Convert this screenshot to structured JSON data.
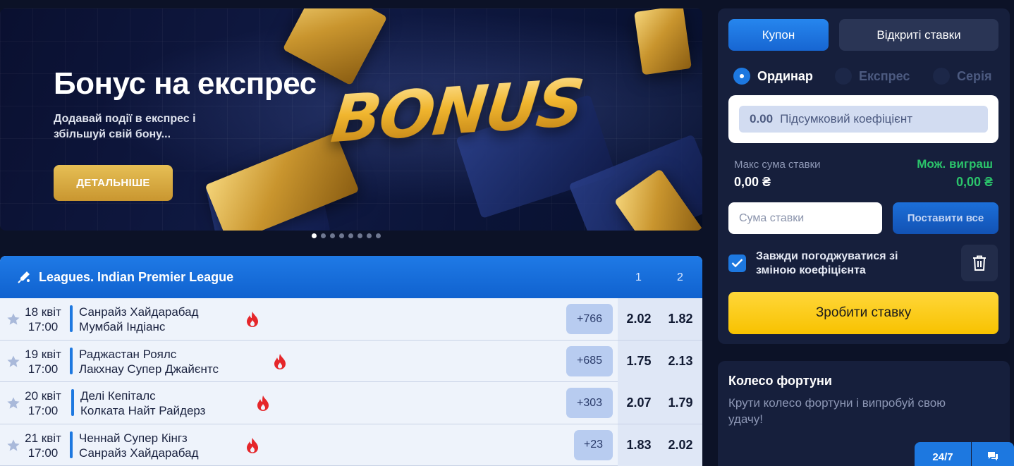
{
  "banner": {
    "title": "Бонус на експрес",
    "text": "Додавай події в експрес і збільшуй свій бону...",
    "button_label": "ДЕТАЛЬНІШЕ",
    "bonus_word": "BONUS",
    "slides_count": 8,
    "active_slide": 1
  },
  "league": {
    "name": "Leagues. Indian Premier League",
    "col1": "1",
    "col2": "2"
  },
  "matches": [
    {
      "date": "18 квіт",
      "time": "17:00",
      "team1": "Санрайз Хайдарабад",
      "team2": "Мумбай Індіанс",
      "markets": "+766",
      "odd1": "2.02",
      "odd2": "1.82"
    },
    {
      "date": "19 квіт",
      "time": "17:00",
      "team1": "Раджастан Роялс",
      "team2": "Лакхнау Супер Джайєнтс",
      "markets": "+685",
      "odd1": "1.75",
      "odd2": "2.13"
    },
    {
      "date": "20 квіт",
      "time": "17:00",
      "team1": "Делі Кепіталс",
      "team2": "Колката Найт Райдерз",
      "markets": "+303",
      "odd1": "2.07",
      "odd2": "1.79"
    },
    {
      "date": "21 квіт",
      "time": "17:00",
      "team1": "Ченнай Супер Кінгз",
      "team2": "Санрайз Хайдарабад",
      "markets": "+23",
      "odd1": "1.83",
      "odd2": "2.02"
    }
  ],
  "coupon": {
    "tab_active": "Купон",
    "tab_other": "Відкриті ставки",
    "radio_single": "Ординар",
    "radio_express": "Експрес",
    "radio_series": "Серія",
    "total_coef_value": "0.00",
    "total_coef_label": "Підсумковий коефіцієнт",
    "max_stake_label": "Макс сума ставки",
    "max_stake_value": "0,00 ₴",
    "possible_win_label": "Мож. виграш",
    "possible_win_value": "0,00 ₴",
    "stake_placeholder": "Сума ставки",
    "bet_all_label": "Поставити все",
    "accept_changes_label": "Завжди погоджуватися зі зміною коефіцієнта",
    "accept_changes_checked": true,
    "place_bet_label": "Зробити ставку"
  },
  "fortune": {
    "title": "Колесо фортуни",
    "text": "Крути колесо фортуни і випробуй свою удачу!"
  },
  "support": {
    "label": "24/7"
  },
  "colors": {
    "page_bg": "#0c1227",
    "accent_blue": "#1d78e0",
    "gold": "#e6bf55",
    "yellow": "#ffd73a",
    "win_green": "#2bc46b",
    "fire_red": "#e5262a"
  }
}
